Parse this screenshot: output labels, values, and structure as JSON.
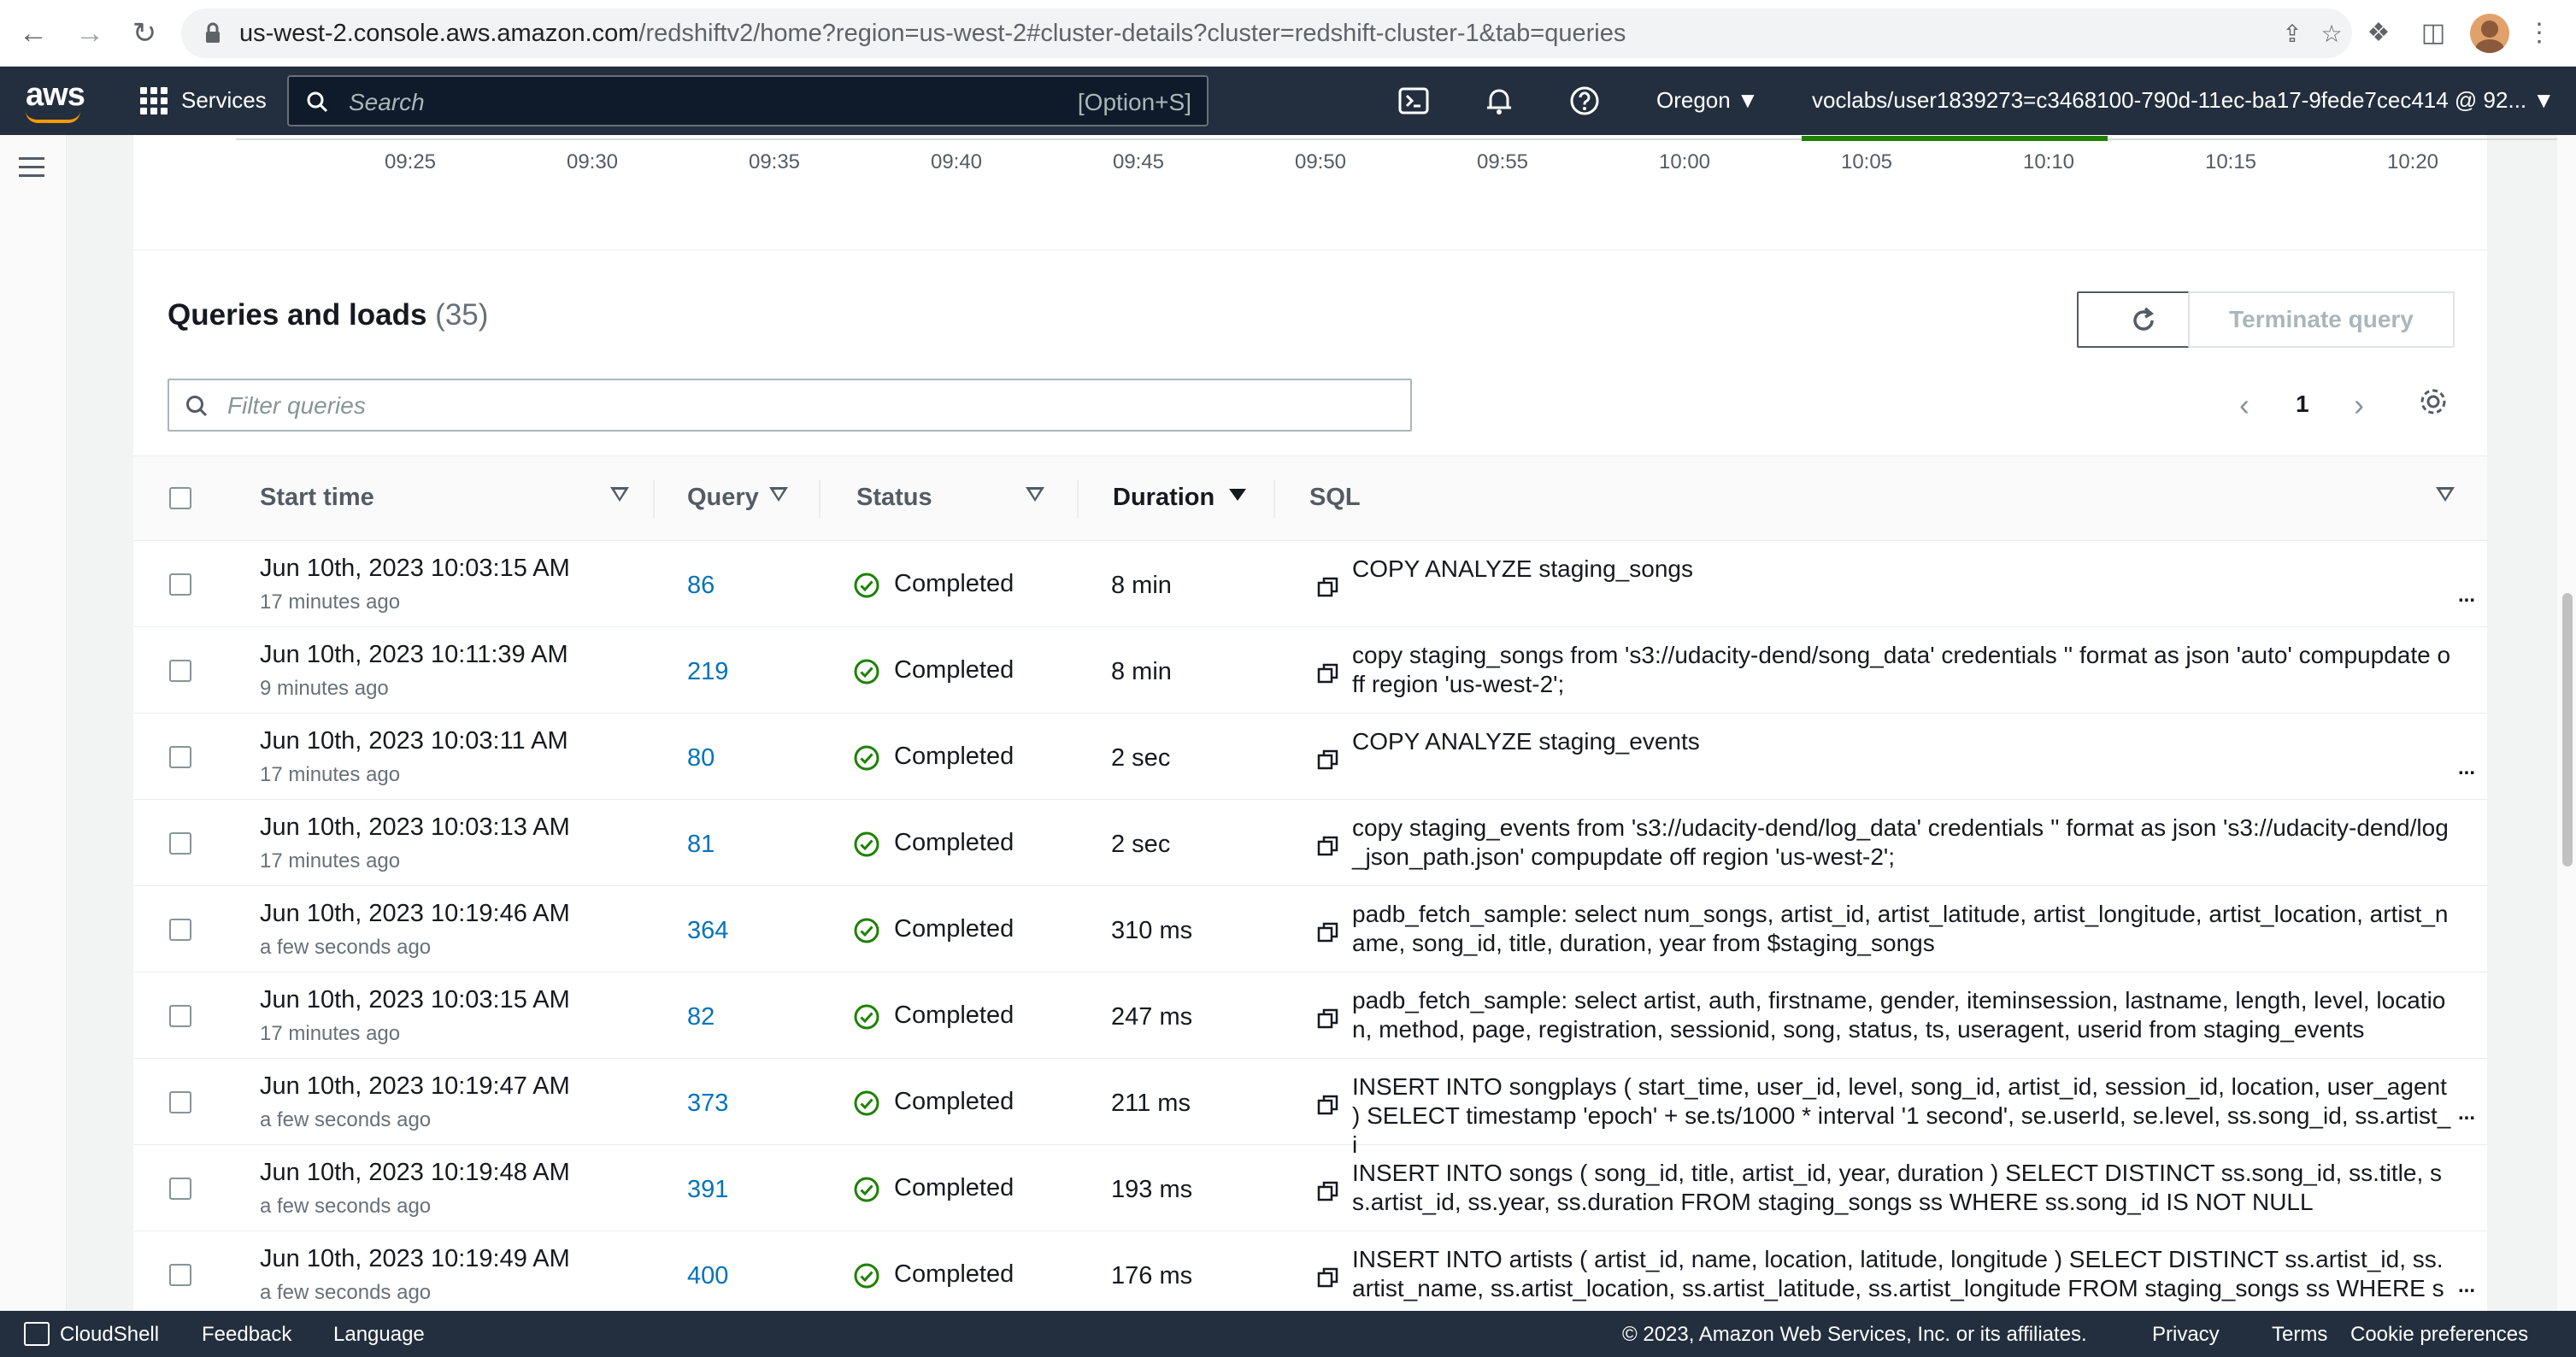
{
  "browser": {
    "url_host": "us-west-2.console.aws.amazon.com",
    "url_path": "/redshiftv2/home?region=us-west-2#cluster-details?cluster=redshift-cluster-1&tab=queries",
    "icons": [
      "back-icon",
      "forward-icon",
      "reload-icon",
      "lock-icon",
      "share-icon",
      "star-icon",
      "extensions-icon",
      "sidepanel-icon",
      "profile-avatar",
      "more-icon"
    ]
  },
  "header": {
    "logo": "aws",
    "services_label": "Services",
    "search_placeholder": "Search",
    "search_shortcut": "[Option+S]",
    "region": "Oregon",
    "account": "voclabs/user1839273=c3468100-790d-11ec-ba17-9fede7cec414 @ 92...",
    "accent_color": "#ff9900"
  },
  "timeline": {
    "ticks": [
      "09:25",
      "09:30",
      "09:35",
      "09:40",
      "09:45",
      "09:50",
      "09:55",
      "10:00",
      "10:05",
      "10:10",
      "10:15",
      "10:20"
    ]
  },
  "panel": {
    "title": "Queries and loads",
    "count": "(35)",
    "terminate_label": "Terminate query",
    "filter_placeholder": "Filter queries",
    "page_number": "1"
  },
  "columns": {
    "start_time": "Start time",
    "query": "Query",
    "status": "Status",
    "duration": "Duration",
    "sql": "SQL"
  },
  "rows": [
    {
      "start": "Jun 10th, 2023 10:03:15 AM",
      "ago": "17 minutes ago",
      "query": "86",
      "status": "Completed",
      "duration": "8 min",
      "sql": "COPY ANALYZE staging_songs",
      "more": "..."
    },
    {
      "start": "Jun 10th, 2023 10:11:39 AM",
      "ago": "9 minutes ago",
      "query": "219",
      "status": "Completed",
      "duration": "8 min",
      "sql": "copy staging_songs from 's3://udacity-dend/song_data' credentials '' format as json 'auto' compupdate off region 'us-west-2';",
      "more": ""
    },
    {
      "start": "Jun 10th, 2023 10:03:11 AM",
      "ago": "17 minutes ago",
      "query": "80",
      "status": "Completed",
      "duration": "2 sec",
      "sql": "COPY ANALYZE staging_events",
      "more": "..."
    },
    {
      "start": "Jun 10th, 2023 10:03:13 AM",
      "ago": "17 minutes ago",
      "query": "81",
      "status": "Completed",
      "duration": "2 sec",
      "sql": "copy staging_events from 's3://udacity-dend/log_data' credentials '' format as json 's3://udacity-dend/log_json_path.json' compupdate off region 'us-west-2';",
      "more": ""
    },
    {
      "start": "Jun 10th, 2023 10:19:46 AM",
      "ago": "a few seconds ago",
      "query": "364",
      "status": "Completed",
      "duration": "310 ms",
      "sql": "padb_fetch_sample: select num_songs, artist_id, artist_latitude, artist_longitude, artist_location, artist_name, song_id, title, duration, year from $staging_songs",
      "more": ""
    },
    {
      "start": "Jun 10th, 2023 10:03:15 AM",
      "ago": "17 minutes ago",
      "query": "82",
      "status": "Completed",
      "duration": "247 ms",
      "sql": "padb_fetch_sample: select artist, auth, firstname, gender, iteminsession, lastname, length, level, location, method, page, registration, sessionid, song, status, ts, useragent, userid from staging_events",
      "more": ""
    },
    {
      "start": "Jun 10th, 2023 10:19:47 AM",
      "ago": "a few seconds ago",
      "query": "373",
      "status": "Completed",
      "duration": "211 ms",
      "sql": "INSERT INTO songplays ( start_time, user_id, level, song_id, artist_id, session_id, location, user_agent ) SELECT timestamp 'epoch' + se.ts/1000 * interval '1 second', se.userId, se.level, ss.song_id, ss.artist_i",
      "more": "..."
    },
    {
      "start": "Jun 10th, 2023 10:19:48 AM",
      "ago": "a few seconds ago",
      "query": "391",
      "status": "Completed",
      "duration": "193 ms",
      "sql": "INSERT INTO songs ( song_id, title, artist_id, year, duration ) SELECT DISTINCT ss.song_id, ss.title, ss.artist_id, ss.year, ss.duration FROM staging_songs ss WHERE ss.song_id IS NOT NULL",
      "more": ""
    },
    {
      "start": "Jun 10th, 2023 10:19:49 AM",
      "ago": "a few seconds ago",
      "query": "400",
      "status": "Completed",
      "duration": "176 ms",
      "sql": "INSERT INTO artists ( artist_id, name, location, latitude, longitude ) SELECT DISTINCT ss.artist_id, ss.artist_name, ss.artist_location, ss.artist_latitude, ss.artist_longitude FROM staging_songs ss WHERE ss.",
      "more": "..."
    }
  ],
  "footer": {
    "cloudshell": "CloudShell",
    "feedback": "Feedback",
    "language": "Language",
    "copyright": "© 2023, Amazon Web Services, Inc. or its affiliates.",
    "privacy": "Privacy",
    "terms": "Terms",
    "cookies": "Cookie preferences"
  },
  "colors": {
    "header_bg": "#232f3e",
    "link": "#0073bb",
    "success": "#1d8102"
  }
}
